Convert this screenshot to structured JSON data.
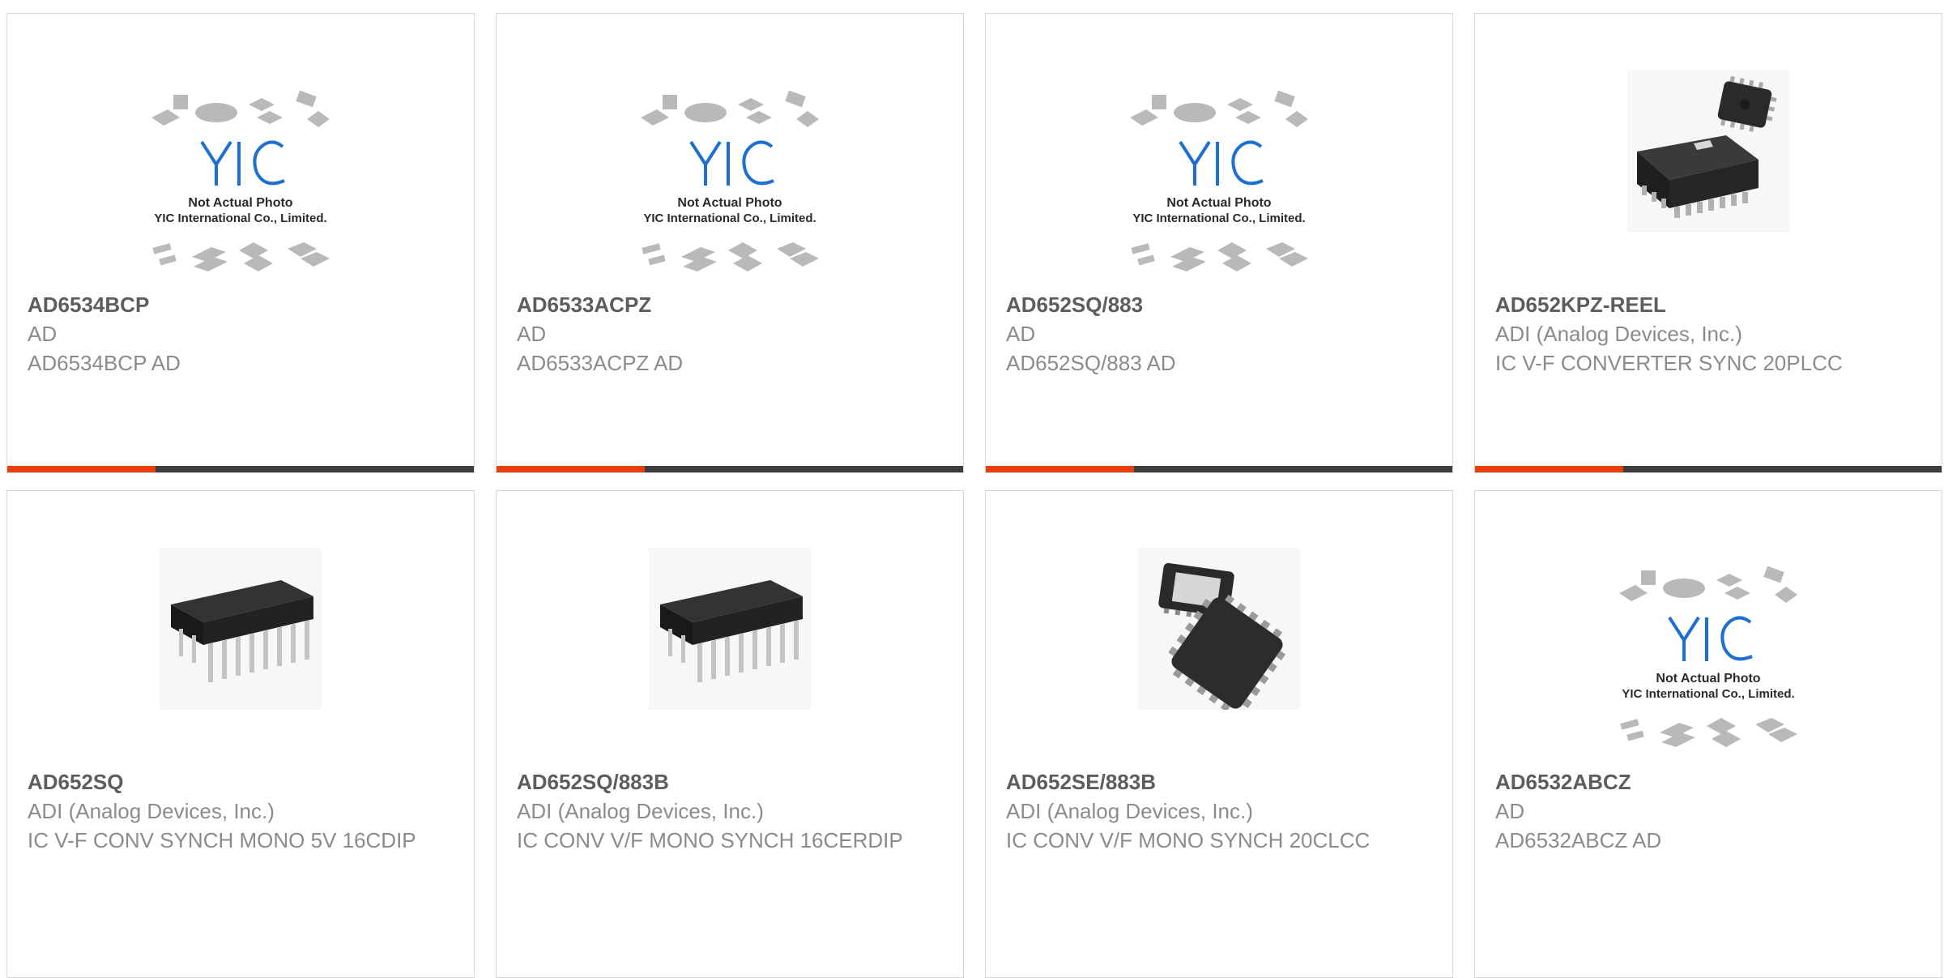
{
  "products": [
    {
      "part": "AD6534BCP",
      "maker": "AD",
      "desc": "AD6534BCP AD",
      "image": "placeholder",
      "image_icon": "yic-placeholder-icon",
      "placeholder_line1": "Not Actual Photo",
      "placeholder_line2": "YIC International Co., Limited."
    },
    {
      "part": "AD6533ACPZ",
      "maker": "AD",
      "desc": "AD6533ACPZ AD",
      "image": "placeholder",
      "image_icon": "yic-placeholder-icon",
      "placeholder_line1": "Not Actual Photo",
      "placeholder_line2": "YIC International Co., Limited."
    },
    {
      "part": "AD652SQ/883",
      "maker": "AD",
      "desc": "AD652SQ/883 AD",
      "image": "placeholder",
      "image_icon": "yic-placeholder-icon",
      "placeholder_line1": "Not Actual Photo",
      "placeholder_line2": "YIC International Co., Limited."
    },
    {
      "part": "AD652KPZ-REEL",
      "maker": "ADI (Analog Devices, Inc.)",
      "desc": "IC V-F CONVERTER SYNC 20PLCC",
      "image": "plcc",
      "image_icon": "plcc-chip-icon"
    },
    {
      "part": "AD652SQ",
      "maker": "ADI (Analog Devices, Inc.)",
      "desc": "IC V-F CONV SYNCH MONO 5V 16CDIP",
      "image": "dip",
      "image_icon": "dip-chip-icon"
    },
    {
      "part": "AD652SQ/883B",
      "maker": "ADI (Analog Devices, Inc.)",
      "desc": "IC CONV V/F MONO SYNCH 16CERDIP",
      "image": "dip",
      "image_icon": "dip-chip-icon"
    },
    {
      "part": "AD652SE/883B",
      "maker": "ADI (Analog Devices, Inc.)",
      "desc": "IC CONV V/F MONO SYNCH 20CLCC",
      "image": "clcc",
      "image_icon": "clcc-chip-icon"
    },
    {
      "part": "AD6532ABCZ",
      "maker": "AD",
      "desc": "AD6532ABCZ AD",
      "image": "placeholder",
      "image_icon": "yic-placeholder-icon",
      "placeholder_line1": "Not Actual Photo",
      "placeholder_line2": "YIC International Co., Limited."
    }
  ],
  "colors": {
    "accent": "#e8400c",
    "bar": "#3d3d3d",
    "part_text": "#5d5d5d",
    "meta_text": "#8b8b8b",
    "logo_blue": "#1d6fd0"
  }
}
